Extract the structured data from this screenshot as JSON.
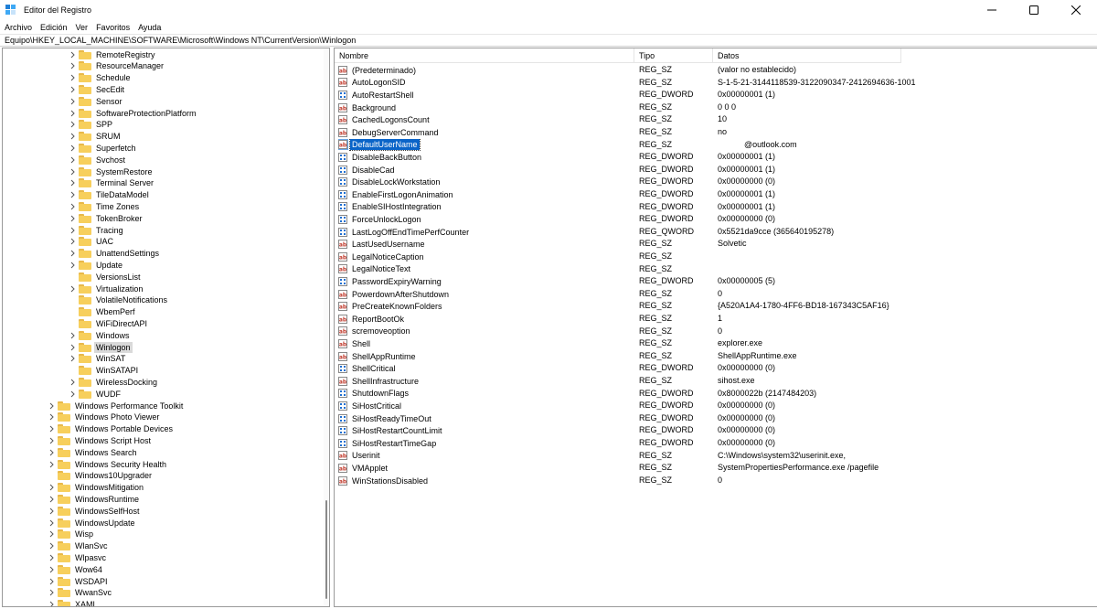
{
  "window": {
    "title": "Editor del Registro"
  },
  "menu": [
    {
      "label": "Archivo",
      "name": "menu-archivo"
    },
    {
      "label": "Edición",
      "name": "menu-edicion"
    },
    {
      "label": "Ver",
      "name": "menu-ver"
    },
    {
      "label": "Favoritos",
      "name": "menu-favoritos"
    },
    {
      "label": "Ayuda",
      "name": "menu-ayuda"
    }
  ],
  "address": {
    "path": "Equipo\\HKEY_LOCAL_MACHINE\\SOFTWARE\\Microsoft\\Windows NT\\CurrentVersion\\Winlogon"
  },
  "tree": {
    "selected": "Winlogon",
    "items": [
      {
        "label": "RemoteRegistry",
        "level": 2,
        "expand": true
      },
      {
        "label": "ResourceManager",
        "level": 2,
        "expand": true
      },
      {
        "label": "Schedule",
        "level": 2,
        "expand": true
      },
      {
        "label": "SecEdit",
        "level": 2,
        "expand": true
      },
      {
        "label": "Sensor",
        "level": 2,
        "expand": true
      },
      {
        "label": "SoftwareProtectionPlatform",
        "level": 2,
        "expand": true
      },
      {
        "label": "SPP",
        "level": 2,
        "expand": true
      },
      {
        "label": "SRUM",
        "level": 2,
        "expand": true
      },
      {
        "label": "Superfetch",
        "level": 2,
        "expand": true
      },
      {
        "label": "Svchost",
        "level": 2,
        "expand": true
      },
      {
        "label": "SystemRestore",
        "level": 2,
        "expand": true
      },
      {
        "label": "Terminal Server",
        "level": 2,
        "expand": true
      },
      {
        "label": "TileDataModel",
        "level": 2,
        "expand": true
      },
      {
        "label": "Time Zones",
        "level": 2,
        "expand": true
      },
      {
        "label": "TokenBroker",
        "level": 2,
        "expand": true
      },
      {
        "label": "Tracing",
        "level": 2,
        "expand": true
      },
      {
        "label": "UAC",
        "level": 2,
        "expand": true
      },
      {
        "label": "UnattendSettings",
        "level": 2,
        "expand": true
      },
      {
        "label": "Update",
        "level": 2,
        "expand": true
      },
      {
        "label": "VersionsList",
        "level": 2,
        "expand": false
      },
      {
        "label": "Virtualization",
        "level": 2,
        "expand": true
      },
      {
        "label": "VolatileNotifications",
        "level": 2,
        "expand": false
      },
      {
        "label": "WbemPerf",
        "level": 2,
        "expand": false
      },
      {
        "label": "WiFiDirectAPI",
        "level": 2,
        "expand": false
      },
      {
        "label": "Windows",
        "level": 2,
        "expand": true
      },
      {
        "label": "Winlogon",
        "level": 2,
        "expand": true
      },
      {
        "label": "WinSAT",
        "level": 2,
        "expand": true
      },
      {
        "label": "WinSATAPI",
        "level": 2,
        "expand": false
      },
      {
        "label": "WirelessDocking",
        "level": 2,
        "expand": true
      },
      {
        "label": "WUDF",
        "level": 2,
        "expand": true
      },
      {
        "label": "Windows Performance Toolkit",
        "level": 1,
        "expand": true
      },
      {
        "label": "Windows Photo Viewer",
        "level": 1,
        "expand": true
      },
      {
        "label": "Windows Portable Devices",
        "level": 1,
        "expand": true
      },
      {
        "label": "Windows Script Host",
        "level": 1,
        "expand": true
      },
      {
        "label": "Windows Search",
        "level": 1,
        "expand": true
      },
      {
        "label": "Windows Security Health",
        "level": 1,
        "expand": true
      },
      {
        "label": "Windows10Upgrader",
        "level": 1,
        "expand": false
      },
      {
        "label": "WindowsMitigation",
        "level": 1,
        "expand": true
      },
      {
        "label": "WindowsRuntime",
        "level": 1,
        "expand": true
      },
      {
        "label": "WindowsSelfHost",
        "level": 1,
        "expand": true
      },
      {
        "label": "WindowsUpdate",
        "level": 1,
        "expand": true
      },
      {
        "label": "Wisp",
        "level": 1,
        "expand": true
      },
      {
        "label": "WlanSvc",
        "level": 1,
        "expand": true
      },
      {
        "label": "Wlpasvc",
        "level": 1,
        "expand": true
      },
      {
        "label": "Wow64",
        "level": 1,
        "expand": true
      },
      {
        "label": "WSDAPI",
        "level": 1,
        "expand": true
      },
      {
        "label": "WwanSvc",
        "level": 1,
        "expand": true
      },
      {
        "label": "XAML",
        "level": 1,
        "expand": true
      }
    ]
  },
  "list": {
    "columns": {
      "name": "Nombre",
      "type": "Tipo",
      "data": "Datos"
    },
    "selected": "DefaultUserName",
    "rows": [
      {
        "name": "(Predeterminado)",
        "type": "REG_SZ",
        "data": "(valor no establecido)",
        "kind": "sz"
      },
      {
        "name": "AutoLogonSID",
        "type": "REG_SZ",
        "data": "S-1-5-21-3144118539-3122090347-2412694636-1001",
        "kind": "sz"
      },
      {
        "name": "AutoRestartShell",
        "type": "REG_DWORD",
        "data": "0x00000001 (1)",
        "kind": "bin"
      },
      {
        "name": "Background",
        "type": "REG_SZ",
        "data": "0 0 0",
        "kind": "sz"
      },
      {
        "name": "CachedLogonsCount",
        "type": "REG_SZ",
        "data": "10",
        "kind": "sz"
      },
      {
        "name": "DebugServerCommand",
        "type": "REG_SZ",
        "data": "no",
        "kind": "sz"
      },
      {
        "name": "DefaultUserName",
        "type": "REG_SZ",
        "data": "@outlook.com",
        "kind": "sz"
      },
      {
        "name": "DisableBackButton",
        "type": "REG_DWORD",
        "data": "0x00000001 (1)",
        "kind": "bin"
      },
      {
        "name": "DisableCad",
        "type": "REG_DWORD",
        "data": "0x00000001 (1)",
        "kind": "bin"
      },
      {
        "name": "DisableLockWorkstation",
        "type": "REG_DWORD",
        "data": "0x00000000 (0)",
        "kind": "bin"
      },
      {
        "name": "EnableFirstLogonAnimation",
        "type": "REG_DWORD",
        "data": "0x00000001 (1)",
        "kind": "bin"
      },
      {
        "name": "EnableSIHostIntegration",
        "type": "REG_DWORD",
        "data": "0x00000001 (1)",
        "kind": "bin"
      },
      {
        "name": "ForceUnlockLogon",
        "type": "REG_DWORD",
        "data": "0x00000000 (0)",
        "kind": "bin"
      },
      {
        "name": "LastLogOffEndTimePerfCounter",
        "type": "REG_QWORD",
        "data": "0x5521da9cce (365640195278)",
        "kind": "bin"
      },
      {
        "name": "LastUsedUsername",
        "type": "REG_SZ",
        "data": "Solvetic",
        "kind": "sz"
      },
      {
        "name": "LegalNoticeCaption",
        "type": "REG_SZ",
        "data": "",
        "kind": "sz"
      },
      {
        "name": "LegalNoticeText",
        "type": "REG_SZ",
        "data": "",
        "kind": "sz"
      },
      {
        "name": "PasswordExpiryWarning",
        "type": "REG_DWORD",
        "data": "0x00000005 (5)",
        "kind": "bin"
      },
      {
        "name": "PowerdownAfterShutdown",
        "type": "REG_SZ",
        "data": "0",
        "kind": "sz"
      },
      {
        "name": "PreCreateKnownFolders",
        "type": "REG_SZ",
        "data": "{A520A1A4-1780-4FF6-BD18-167343C5AF16}",
        "kind": "sz"
      },
      {
        "name": "ReportBootOk",
        "type": "REG_SZ",
        "data": "1",
        "kind": "sz"
      },
      {
        "name": "scremoveoption",
        "type": "REG_SZ",
        "data": "0",
        "kind": "sz"
      },
      {
        "name": "Shell",
        "type": "REG_SZ",
        "data": "explorer.exe",
        "kind": "sz"
      },
      {
        "name": "ShellAppRuntime",
        "type": "REG_SZ",
        "data": "ShellAppRuntime.exe",
        "kind": "sz"
      },
      {
        "name": "ShellCritical",
        "type": "REG_DWORD",
        "data": "0x00000000 (0)",
        "kind": "bin"
      },
      {
        "name": "ShellInfrastructure",
        "type": "REG_SZ",
        "data": "sihost.exe",
        "kind": "sz"
      },
      {
        "name": "ShutdownFlags",
        "type": "REG_DWORD",
        "data": "0x8000022b (2147484203)",
        "kind": "bin"
      },
      {
        "name": "SiHostCritical",
        "type": "REG_DWORD",
        "data": "0x00000000 (0)",
        "kind": "bin"
      },
      {
        "name": "SiHostReadyTimeOut",
        "type": "REG_DWORD",
        "data": "0x00000000 (0)",
        "kind": "bin"
      },
      {
        "name": "SiHostRestartCountLimit",
        "type": "REG_DWORD",
        "data": "0x00000000 (0)",
        "kind": "bin"
      },
      {
        "name": "SiHostRestartTimeGap",
        "type": "REG_DWORD",
        "data": "0x00000000 (0)",
        "kind": "bin"
      },
      {
        "name": "Userinit",
        "type": "REG_SZ",
        "data": "C:\\Windows\\system32\\userinit.exe,",
        "kind": "sz"
      },
      {
        "name": "VMApplet",
        "type": "REG_SZ",
        "data": "SystemPropertiesPerformance.exe /pagefile",
        "kind": "sz"
      },
      {
        "name": "WinStationsDisabled",
        "type": "REG_SZ",
        "data": "0",
        "kind": "sz"
      }
    ]
  },
  "icons": {
    "string_value": "ab-string-icon",
    "binary_value": "binary-value-icon",
    "folder": "folder-icon",
    "chevron": "chevron-right-icon"
  },
  "colors": {
    "selection": "#0a64c8",
    "folder": "#f7cf5c",
    "string_icon_text": "#c0392b",
    "binary_icon": "#1f6fd1"
  }
}
